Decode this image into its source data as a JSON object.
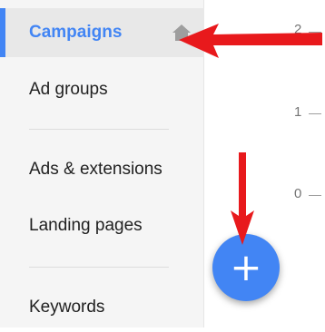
{
  "sidebar": {
    "items": [
      {
        "label": "Campaigns",
        "active": true,
        "icon": "home-icon"
      },
      {
        "label": "Ad groups"
      },
      {
        "label": "Ads & extensions"
      },
      {
        "label": "Landing pages"
      },
      {
        "label": "Keywords"
      }
    ]
  },
  "chart": {
    "ticks": [
      "2",
      "1",
      "0"
    ]
  },
  "fab": {
    "label": "+"
  },
  "colors": {
    "accent": "#4285f4",
    "annotation_arrow": "#e8191c",
    "sidebar_bg": "#f5f5f5"
  }
}
